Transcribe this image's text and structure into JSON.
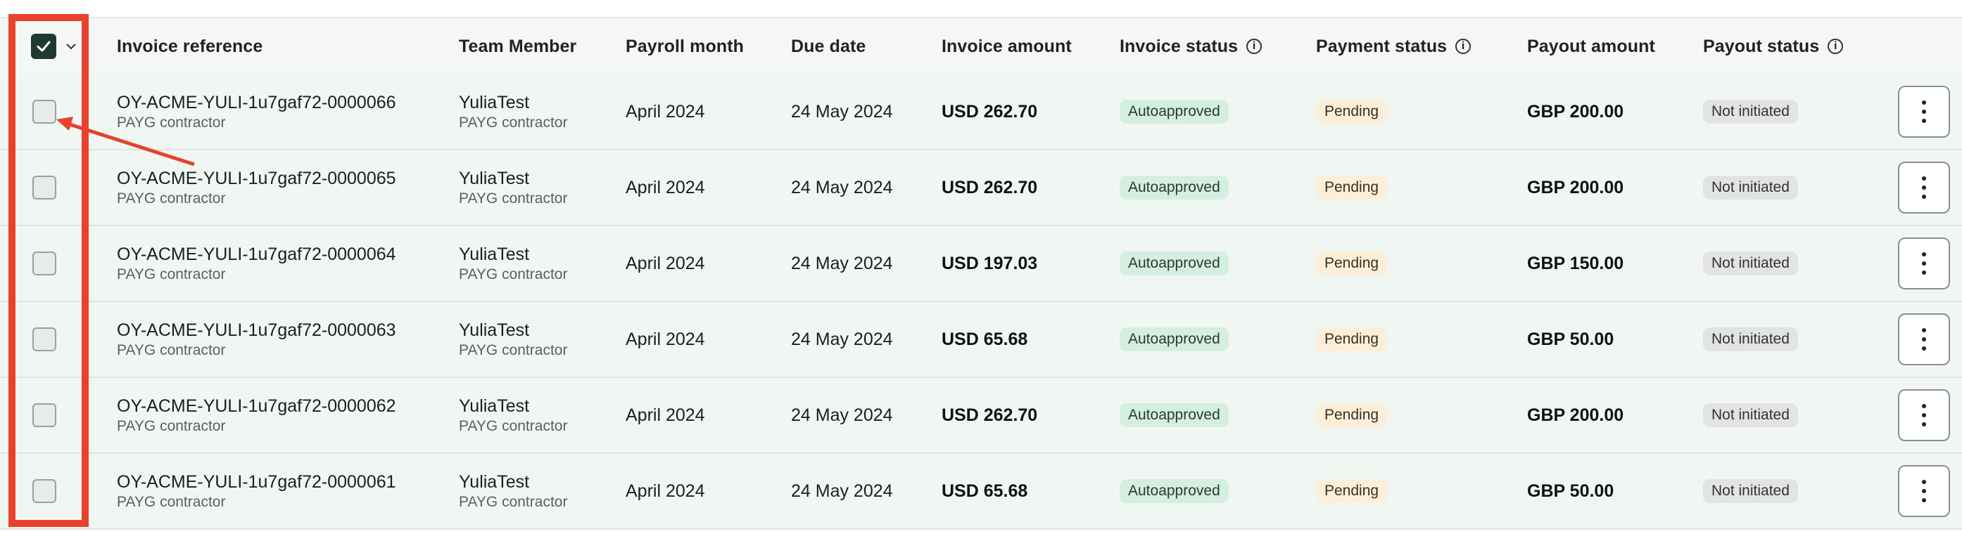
{
  "header": {
    "invoice_reference": "Invoice reference",
    "team_member": "Team Member",
    "payroll_month": "Payroll month",
    "due_date": "Due date",
    "invoice_amount": "Invoice amount",
    "invoice_status": "Invoice status",
    "payment_status": "Payment status",
    "payout_amount": "Payout amount",
    "payout_status": "Payout status",
    "info_icon": "info-icon",
    "select_all_checked": true
  },
  "rows": [
    {
      "ref": "OY-ACME-YULI-1u7gaf72-0000066",
      "ref_sub": "PAYG contractor",
      "member": "YuliaTest",
      "member_sub": "PAYG contractor",
      "month": "April 2024",
      "due": "24 May 2024",
      "amount": "USD 262.70",
      "inv_status": "Autoapproved",
      "pay_status": "Pending",
      "payout": "GBP 200.00",
      "payout_status": "Not initiated"
    },
    {
      "ref": "OY-ACME-YULI-1u7gaf72-0000065",
      "ref_sub": "PAYG contractor",
      "member": "YuliaTest",
      "member_sub": "PAYG contractor",
      "month": "April 2024",
      "due": "24 May 2024",
      "amount": "USD 262.70",
      "inv_status": "Autoapproved",
      "pay_status": "Pending",
      "payout": "GBP 200.00",
      "payout_status": "Not initiated"
    },
    {
      "ref": "OY-ACME-YULI-1u7gaf72-0000064",
      "ref_sub": "PAYG contractor",
      "member": "YuliaTest",
      "member_sub": "PAYG contractor",
      "month": "April 2024",
      "due": "24 May 2024",
      "amount": "USD 197.03",
      "inv_status": "Autoapproved",
      "pay_status": "Pending",
      "payout": "GBP 150.00",
      "payout_status": "Not initiated"
    },
    {
      "ref": "OY-ACME-YULI-1u7gaf72-0000063",
      "ref_sub": "PAYG contractor",
      "member": "YuliaTest",
      "member_sub": "PAYG contractor",
      "month": "April 2024",
      "due": "24 May 2024",
      "amount": "USD 65.68",
      "inv_status": "Autoapproved",
      "pay_status": "Pending",
      "payout": "GBP 50.00",
      "payout_status": "Not initiated"
    },
    {
      "ref": "OY-ACME-YULI-1u7gaf72-0000062",
      "ref_sub": "PAYG contractor",
      "member": "YuliaTest",
      "member_sub": "PAYG contractor",
      "month": "April 2024",
      "due": "24 May 2024",
      "amount": "USD 262.70",
      "inv_status": "Autoapproved",
      "pay_status": "Pending",
      "payout": "GBP 200.00",
      "payout_status": "Not initiated"
    },
    {
      "ref": "OY-ACME-YULI-1u7gaf72-0000061",
      "ref_sub": "PAYG contractor",
      "member": "YuliaTest",
      "member_sub": "PAYG contractor",
      "month": "April 2024",
      "due": "24 May 2024",
      "amount": "USD 65.68",
      "inv_status": "Autoapproved",
      "pay_status": "Pending",
      "payout": "GBP 50.00",
      "payout_status": "Not initiated"
    }
  ],
  "colors": {
    "highlight": "#e8412c",
    "checkbox_checked": "#1e3b30",
    "row_bg": "#f0f7f3",
    "badge_autoapproved": "#d5eee2",
    "badge_pending": "#fbefd9",
    "badge_not_initiated": "#e3e3e3"
  },
  "annotation": {
    "type": "red rectangle around checkbox column with arrow pointing to first row checkbox"
  }
}
